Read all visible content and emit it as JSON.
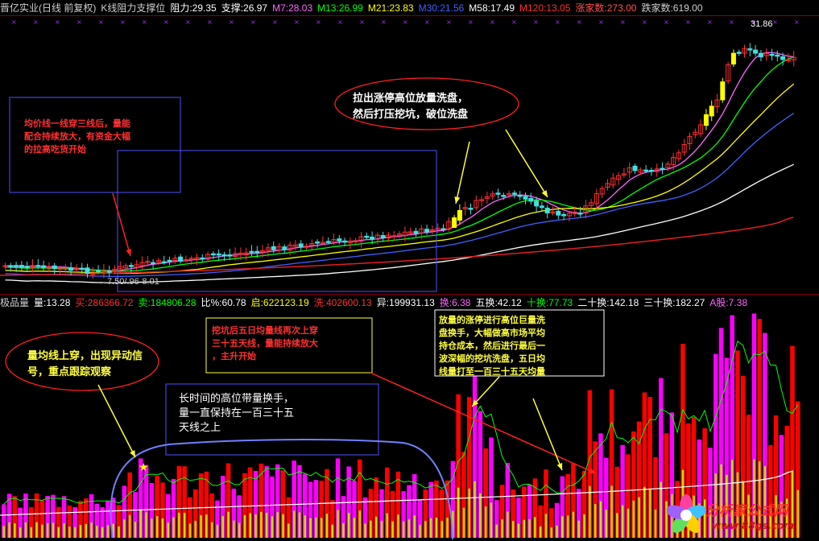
{
  "header_top": {
    "stock": "晋亿实业(日线 前复权)",
    "indicator": "K线阻力支撑位",
    "resistance": "阻力:29.35",
    "support": "支撑:26.97",
    "m7": "M7:28.03",
    "m13": "M13:26.99",
    "m21": "M21:23.83",
    "m30": "M30:21.56",
    "m58": "M58:17.49",
    "m120": "M120:13.05",
    "up_count": "涨家数:273.00",
    "down_count": "跌家数:619.00"
  },
  "header_volume": {
    "name": "极品量",
    "val": "量:13.28",
    "buy": "买:286366.72",
    "sell": "卖:184806.28",
    "ratio": "比%:60.78",
    "qi": "启:622123.19",
    "xi": "洗:402600.13",
    "yi": "异:199931.13",
    "huan": "换:6.38",
    "wuhuan": "五换:42.12",
    "shihuan": "十换:77.73",
    "ershihuan": "二十换:142.18",
    "sanshihuan": "三十换:182.27",
    "agu": "A股:7.38"
  },
  "colors": {
    "up": "#ff3030",
    "down": "#40e0e0",
    "limit": "#ffff00",
    "vol_up": "#ff0000",
    "vol_down": "#ff00ff",
    "vol_inner": "#c8e000",
    "ma_m7": "#ff66ff",
    "ma_m13": "#00ff00",
    "ma_m21": "#ffff00",
    "ma_m30": "#4060ff",
    "ma_m58": "#ffffff",
    "ma_m120": "#e02020",
    "annot_box": "#5050ff",
    "annot_arrow_red": "#ff2020",
    "annot_arrow_yellow": "#ffff33",
    "annot_text_red": "#ff3030",
    "annot_text_yellow": "#ffff40"
  },
  "annotations": {
    "note1": [
      "均价线一线穿三线后，量能",
      "配合持续放大，有资金大幅",
      "的拉高吃货开始"
    ],
    "note2": [
      "拉出涨停高位放量洗盘，",
      "然后打压挖坑，破位洗盘"
    ],
    "note3": [
      "量均线上穿，出现异动信",
      "号，重点跟踪观察"
    ],
    "note4": [
      "挖坑后五日均量线再次上穿",
      "三十五天线，量能持续放大",
      "，主升开始"
    ],
    "note5": [
      "放量的涨停进行高位巨量洗",
      "盘换手，大幅做高市场平均",
      "持仓成本，然后进行最后一",
      "波深幅的挖坑洗盘，五日均",
      "线量打至一百三十五天均量"
    ],
    "note6": [
      "长时间的高位带量换手，",
      "量一直保持在一百三十五",
      "天线之上"
    ],
    "price_high": "31.86",
    "price_low": "←7.50/.96-8.01"
  },
  "logo": {
    "text": "分析家公式网",
    "url": "www.88gs.com"
  },
  "chart_data": {
    "type": "candlestick",
    "y_axis_hint": "price (CNY)",
    "price_high_label": 31.86,
    "price_low_label": 7.5,
    "moving_averages": [
      "M7",
      "M13",
      "M21",
      "M30",
      "M58",
      "M120"
    ],
    "volume_panel": "bars with 5-day and 135-day volume averages"
  }
}
